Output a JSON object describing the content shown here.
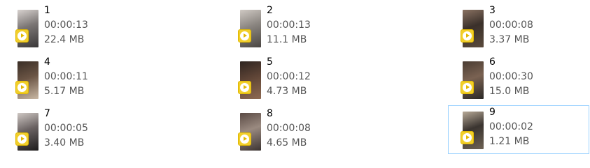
{
  "files": [
    {
      "name": "1",
      "duration": "00:00:13",
      "size": "22.4 MB",
      "thumb_colors": [
        "#3a3838",
        "#7a7574",
        "#d8d2cf"
      ]
    },
    {
      "name": "2",
      "duration": "00:00:13",
      "size": "11.1 MB",
      "thumb_colors": [
        "#4a4642",
        "#8a8580",
        "#cfc9c3"
      ]
    },
    {
      "name": "3",
      "duration": "00:00:08",
      "size": "3.37 MB",
      "thumb_colors": [
        "#5a4a3c",
        "#3a302a",
        "#8a7262"
      ]
    },
    {
      "name": "4",
      "duration": "00:00:11",
      "size": "5.17 MB",
      "thumb_colors": [
        "#c9b8a4",
        "#6a5444",
        "#3a2e26"
      ]
    },
    {
      "name": "5",
      "duration": "00:00:12",
      "size": "4.73 MB",
      "thumb_colors": [
        "#8e6a52",
        "#5e4436",
        "#2e2420"
      ]
    },
    {
      "name": "6",
      "duration": "00:00:30",
      "size": "15.0 MB",
      "thumb_colors": [
        "#2a2826",
        "#7a6252",
        "#4a3c32"
      ]
    },
    {
      "name": "7",
      "duration": "00:00:05",
      "size": "3.40 MB",
      "thumb_colors": [
        "#1e1c1c",
        "#6a6262",
        "#cfc8c4"
      ]
    },
    {
      "name": "8",
      "duration": "00:00:08",
      "size": "4.65 MB",
      "thumb_colors": [
        "#3c3432",
        "#9a8a80",
        "#5a4a44"
      ]
    },
    {
      "name": "9",
      "duration": "00:00:02",
      "size": "1.21 MB",
      "thumb_colors": [
        "#6e6254",
        "#3a3430",
        "#b8aa98"
      ]
    }
  ],
  "selected_file": "9",
  "colors": {
    "badge_fill": "#f2cf2a",
    "play_triangle": "#e2b800",
    "selection_border": "#99d1ff",
    "secondary_text": "#555555"
  },
  "icons": {
    "file_thumbnail": "video-thumbnail",
    "overlay": "play-badge-icon"
  }
}
